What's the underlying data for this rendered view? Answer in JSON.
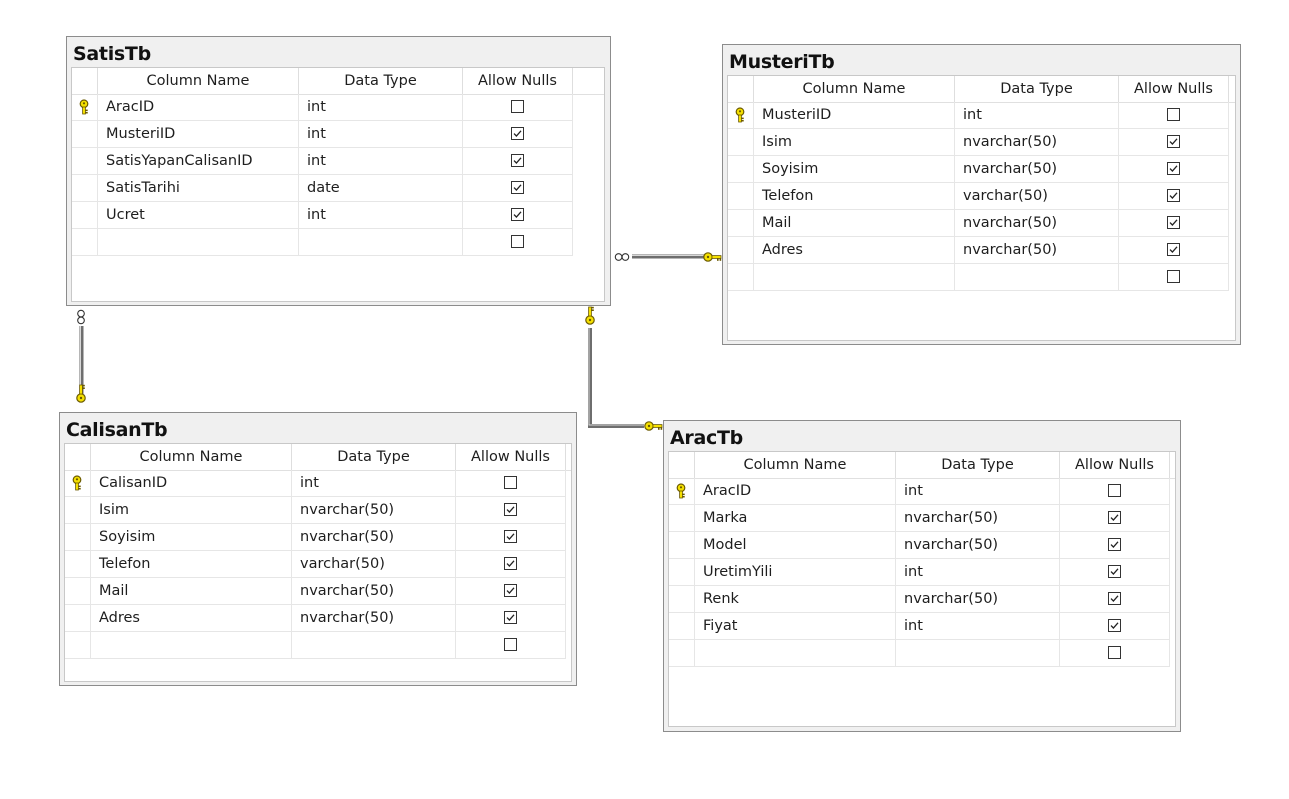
{
  "headers": {
    "column_name": "Column Name",
    "data_type": "Data Type",
    "allow_nulls": "Allow Nulls"
  },
  "tables": {
    "satis": {
      "title": "SatisTb",
      "rows": [
        {
          "name": "AracID",
          "type": "int",
          "nulls": false,
          "pk": true
        },
        {
          "name": "MusteriID",
          "type": "int",
          "nulls": true,
          "pk": false
        },
        {
          "name": "SatisYapanCalisanID",
          "type": "int",
          "nulls": true,
          "pk": false
        },
        {
          "name": "SatisTarihi",
          "type": "date",
          "nulls": true,
          "pk": false
        },
        {
          "name": "Ucret",
          "type": "int",
          "nulls": true,
          "pk": false
        },
        {
          "name": "",
          "type": "",
          "nulls": false,
          "pk": false
        }
      ]
    },
    "musteri": {
      "title": "MusteriTb",
      "rows": [
        {
          "name": "MusteriID",
          "type": "int",
          "nulls": false,
          "pk": true
        },
        {
          "name": "Isim",
          "type": "nvarchar(50)",
          "nulls": true,
          "pk": false
        },
        {
          "name": "Soyisim",
          "type": "nvarchar(50)",
          "nulls": true,
          "pk": false
        },
        {
          "name": "Telefon",
          "type": "varchar(50)",
          "nulls": true,
          "pk": false
        },
        {
          "name": "Mail",
          "type": "nvarchar(50)",
          "nulls": true,
          "pk": false
        },
        {
          "name": "Adres",
          "type": "nvarchar(50)",
          "nulls": true,
          "pk": false
        },
        {
          "name": "",
          "type": "",
          "nulls": false,
          "pk": false
        }
      ]
    },
    "calisan": {
      "title": "CalisanTb",
      "rows": [
        {
          "name": "CalisanID",
          "type": "int",
          "nulls": false,
          "pk": true
        },
        {
          "name": "Isim",
          "type": "nvarchar(50)",
          "nulls": true,
          "pk": false
        },
        {
          "name": "Soyisim",
          "type": "nvarchar(50)",
          "nulls": true,
          "pk": false
        },
        {
          "name": "Telefon",
          "type": "varchar(50)",
          "nulls": true,
          "pk": false
        },
        {
          "name": "Mail",
          "type": "nvarchar(50)",
          "nulls": true,
          "pk": false
        },
        {
          "name": "Adres",
          "type": "nvarchar(50)",
          "nulls": true,
          "pk": false
        },
        {
          "name": "",
          "type": "",
          "nulls": false,
          "pk": false
        }
      ]
    },
    "arac": {
      "title": "AracTb",
      "rows": [
        {
          "name": "AracID",
          "type": "int",
          "nulls": false,
          "pk": true
        },
        {
          "name": "Marka",
          "type": "nvarchar(50)",
          "nulls": true,
          "pk": false
        },
        {
          "name": "Model",
          "type": "nvarchar(50)",
          "nulls": true,
          "pk": false
        },
        {
          "name": "UretimYili",
          "type": "int",
          "nulls": true,
          "pk": false
        },
        {
          "name": "Renk",
          "type": "nvarchar(50)",
          "nulls": true,
          "pk": false
        },
        {
          "name": "Fiyat",
          "type": "int",
          "nulls": true,
          "pk": false
        },
        {
          "name": "",
          "type": "",
          "nulls": false,
          "pk": false
        }
      ]
    }
  },
  "colors": {
    "key_yellow": "#f5e000",
    "key_outline": "#6b5a00",
    "line": "#7a7a7a"
  },
  "icons": {
    "primary_key": "key-icon",
    "relationship_one_end": "key-icon",
    "relationship_many_end": "infinity-icon"
  }
}
